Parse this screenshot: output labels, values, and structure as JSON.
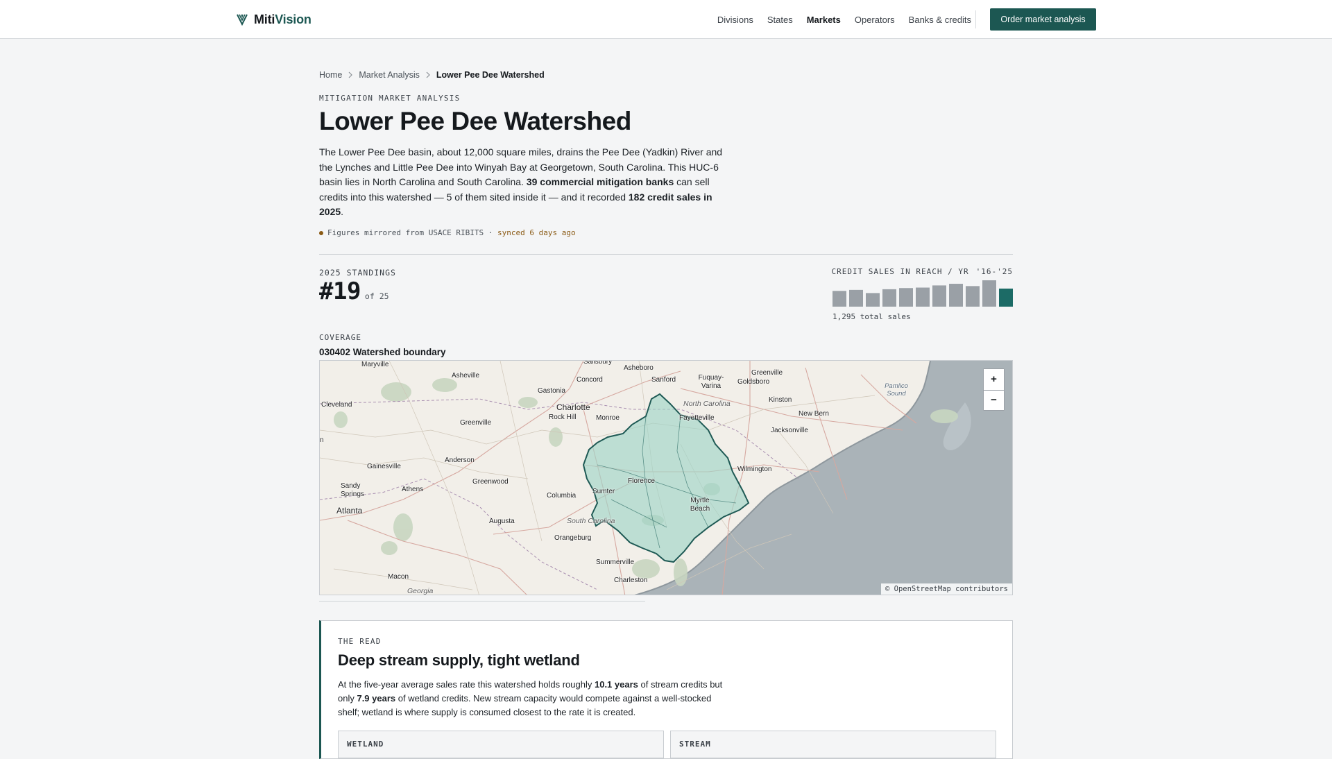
{
  "nav": {
    "logo_prefix": "Miti",
    "logo_suffix": "Vision",
    "links": [
      {
        "label": "Divisions"
      },
      {
        "label": "States"
      },
      {
        "label": "Markets"
      },
      {
        "label": "Operators"
      },
      {
        "label": "Banks & credits"
      }
    ],
    "cta": "Order market analysis"
  },
  "breadcrumb": [
    "Home",
    "Market Analysis",
    "Lower Pee Dee Watershed"
  ],
  "eyebrow": "MITIGATION MARKET ANALYSIS",
  "title": "Lower Pee Dee Watershed",
  "intro": {
    "p1": "The Lower Pee Dee basin, about 12,000 square miles, drains the Pee Dee (Yadkin) River and the Lynches and Little Pee Dee into Winyah Bay at Georgetown, South Carolina. This HUC-6 basin lies in North Carolina and South Carolina. ",
    "banks_bold": "39 commercial mitigation banks",
    "p2": " can sell credits into this watershed — 5 of them sited inside it — and it recorded ",
    "sales_bold": "182 credit sales in 2025",
    "p3": "."
  },
  "sync": {
    "text": "Figures mirrored from USACE RIBITS · ",
    "accent": "synced 6 days ago"
  },
  "standings": {
    "label": "2025 STANDINGS",
    "rank": "#19",
    "of": "of 25"
  },
  "sparkline": {
    "label": "CREDIT SALES IN REACH / YR",
    "range": "'16-'25",
    "total": "1,295 total sales",
    "values": [
      95,
      101,
      82,
      105,
      112,
      115,
      128,
      138,
      124,
      159,
      109
    ],
    "bar_color": "#9aa0a6",
    "highlight_color": "#1c6b66"
  },
  "coverage": {
    "label": "COVERAGE",
    "title": "030402 Watershed boundary"
  },
  "map": {
    "attribution": "© OpenStreetMap contributors",
    "zoom_in": "+",
    "zoom_out": "−",
    "places": [
      "Maryville",
      "Asheville",
      "Salisbury",
      "Asheboro",
      "Greenville",
      "Concord",
      "Sanford",
      "Goldsboro",
      "Gastonia",
      "Fuquay-Varina",
      "North Carolina",
      "Charlotte",
      "Rock Hill",
      "Monroe",
      "Cleveland",
      "Greenville",
      "Kinston",
      "New Bern",
      "Fayetteville",
      "Jacksonville",
      "Anderson",
      "Gainesville",
      "Wilmington",
      "Greenwood",
      "Sandy Springs",
      "Athens",
      "Florence",
      "Sumter",
      "Columbia",
      "Atlanta",
      "Myrtle Beach",
      "South Carolina",
      "Augusta",
      "Orangeburg",
      "Summerville",
      "Macon",
      "Charleston",
      "Georgia",
      "Pamlico Sound",
      "n"
    ]
  },
  "read": {
    "eyebrow": "THE READ",
    "title": "Deep stream supply, tight wetland",
    "p1": "At the five-year average sales rate this watershed holds roughly ",
    "stream_years": "10.1 years",
    "p2": " of stream credits but only ",
    "wetland_years": "7.9 years",
    "p3": " of wetland credits. New stream capacity would compete against a well-stocked shelf; wetland is where supply is consumed closest to the rate it is created.",
    "cards": [
      {
        "label": "WETLAND"
      },
      {
        "label": "STREAM"
      }
    ]
  }
}
